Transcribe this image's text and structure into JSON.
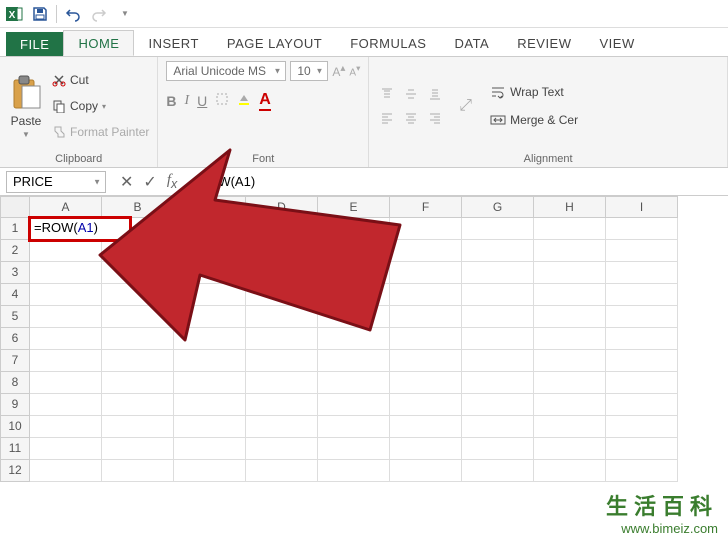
{
  "app": {
    "name": "Excel"
  },
  "tabs": {
    "file": "FILE",
    "home": "HOME",
    "insert": "INSERT",
    "page_layout": "PAGE LAYOUT",
    "formulas": "FORMULAS",
    "data": "DATA",
    "review": "REVIEW",
    "view": "VIEW"
  },
  "ribbon": {
    "clipboard": {
      "paste": "Paste",
      "cut": "Cut",
      "copy": "Copy",
      "format_painter": "Format Painter",
      "label": "Clipboard"
    },
    "font": {
      "name": "Arial Unicode MS",
      "size": "10",
      "label": "Font"
    },
    "alignment": {
      "wrap_text": "Wrap Text",
      "merge_center": "Merge & Cer",
      "label": "Alignment"
    }
  },
  "formula_bar": {
    "name_box": "PRICE",
    "formula": "=ROW(A1)"
  },
  "grid": {
    "columns": [
      "A",
      "B",
      "C",
      "D",
      "E",
      "F",
      "G",
      "H",
      "I"
    ],
    "row_count": 12,
    "a1_prefix": "=ROW(",
    "a1_ref": "A1",
    "a1_suffix": ")"
  },
  "watermark": {
    "cn": "生活百科",
    "url": "www.bimeiz.com"
  }
}
